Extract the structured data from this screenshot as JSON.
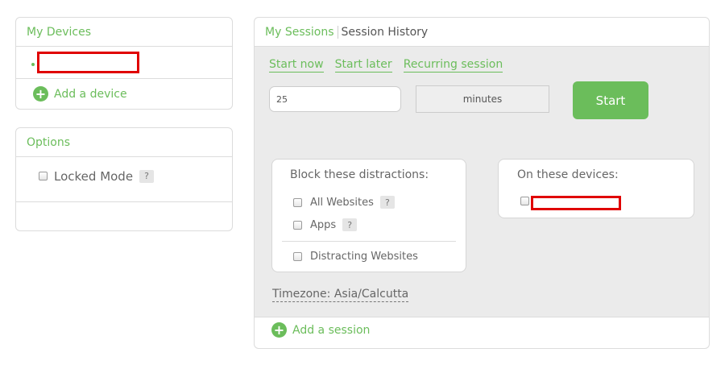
{
  "devices_panel": {
    "title": "My Devices",
    "add_device_label": "Add a device"
  },
  "options_panel": {
    "title": "Options",
    "locked_mode_label": "Locked Mode",
    "help_mark": "?"
  },
  "sessions_panel": {
    "tabs": [
      {
        "label": "My Sessions"
      },
      {
        "label": "Session History"
      }
    ],
    "session_types": [
      {
        "label": "Start now"
      },
      {
        "label": "Start later"
      },
      {
        "label": "Recurring session"
      }
    ],
    "duration_value": "25",
    "duration_unit": "minutes",
    "start_label": "Start",
    "block_title": "Block these distractions:",
    "block_items": [
      {
        "label": "All Websites"
      },
      {
        "label": "Apps"
      },
      {
        "label": "Distracting Websites"
      }
    ],
    "help_mark": "?",
    "devices_title": "On these devices:",
    "timezone_label": "Timezone: Asia/Calcutta",
    "add_session_label": "Add a session"
  },
  "colors": {
    "accent": "#6bbd5b",
    "border": "#dcdcdc",
    "panel_body": "#ebebeb",
    "redaction": "#e00000"
  }
}
